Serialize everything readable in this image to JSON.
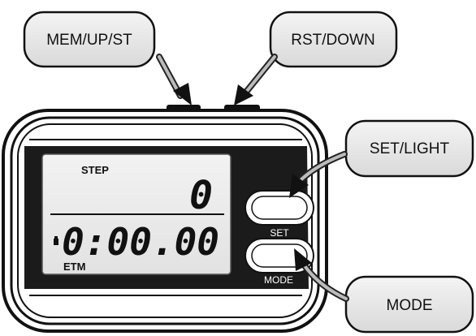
{
  "callouts": {
    "mem_up_st": "MEM/UP/ST",
    "rst_down": "RST/DOWN",
    "set_light": "SET/LIGHT",
    "mode": "MODE"
  },
  "lcd": {
    "step_label": "STEP",
    "step_value": "0",
    "time_value": "0:00.00",
    "etm_label": "ETM"
  },
  "buttons": {
    "set_label": "SET",
    "mode_label": "MODE"
  }
}
